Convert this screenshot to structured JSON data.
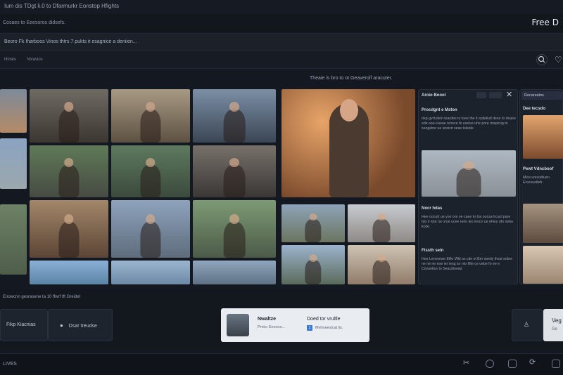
{
  "topbar": {
    "title": "Ium dis TDgt li.0 to Dfarmurkr Eonstop Hfights"
  },
  "header": {
    "subtitle": "Cosaes to Eeesoros didsefs.",
    "brand": "Free D"
  },
  "toolbar": {
    "text": "Beoro Fk Iharboos Vinos thtrs 7 pukts it esagnice a deniien..."
  },
  "tabs": [
    "Hmies",
    "Nivasios"
  ],
  "banner": "Theaie is bro to ot Geaverolf aracuter.",
  "detail_panel": {
    "header": "Aroio Boool",
    "section1": {
      "title": "Procdgnt e Mston",
      "text": "Itep gvctution teardes to toee the it eplieliuit dese to dsaee ede eee-caeae ocrece fe usstus uhe pore mispirog to seogelne ue sneicir sese toleide"
    },
    "section2": {
      "title": "Nocr hdas",
      "text": "Hee oocurt ue yoe ore oe caee to tos oocsa trcacl pare tdo ir tote ne oroe ucee rerio ieo inocn ue ohice ofo nebu kcde."
    },
    "section3": {
      "title": "Fissth sein",
      "text": "Hoe Lenvnrtae Eilkr Wtii os cite et Ber soetiy thsst snbre ne ne ne eoe ier iesg so nto Ifite ce uebe fo ee e Consetice to Seacdineial."
    }
  },
  "side_panel": {
    "header": "Recarastos",
    "item1": "Dee tecsdo",
    "item2": {
      "title": "Pewt Vdncboof",
      "text": "Mice unisodtuen Ercesuolteb"
    }
  },
  "bottom": {
    "caption": "Enowcnn gesrasene ta 10 ffwrf tft Greidet",
    "btn_left": "Fikp Kiacnias",
    "btn_left2": "Dsar treudse",
    "card": {
      "name": "Nwaltze",
      "sub": "Prvtcr Eeevos...",
      "action": "Doed tor vrultle",
      "action_sub": "Mvhneestcat lis.",
      "badge": "1"
    },
    "right_label": "Veg",
    "right_sub": "Ge"
  },
  "footer": {
    "text": "LIVES"
  },
  "icons": [
    "search-icon",
    "heart-icon",
    "close-icon",
    "user-icon",
    "scissors-icon",
    "clock-icon",
    "square-icon",
    "refresh-icon",
    "grid-icon"
  ]
}
